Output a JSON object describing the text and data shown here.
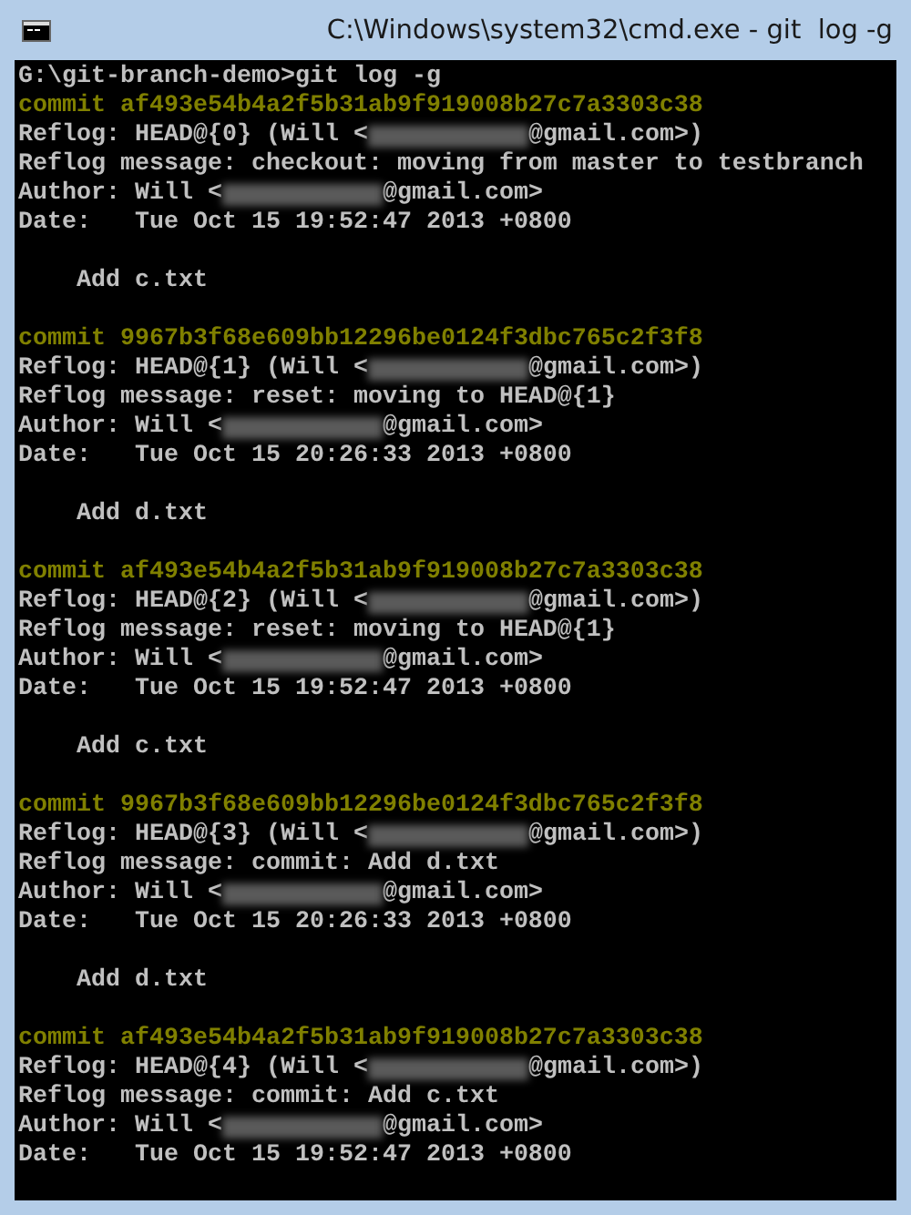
{
  "window": {
    "title": "C:\\Windows\\system32\\cmd.exe - git  log -g"
  },
  "console": {
    "prompt": "G:\\git-branch-demo>git log -g",
    "entries": [
      {
        "commit": "commit af493e54b4a2f5b31ab9f919008b27c7a3303c38",
        "reflog_start": "Reflog: HEAD@{0} (Will <",
        "reflog_end": "@gmail.com>)",
        "message": "Reflog message: checkout: moving from master to testbranch",
        "author_start": "Author: Will <",
        "author_end": "@gmail.com>",
        "date": "Date:   Tue Oct 15 19:52:47 2013 +0800",
        "subject": "    Add c.txt"
      },
      {
        "commit": "commit 9967b3f68e609bb12296be0124f3dbc765c2f3f8",
        "reflog_start": "Reflog: HEAD@{1} (Will <",
        "reflog_end": "@gmail.com>)",
        "message": "Reflog message: reset: moving to HEAD@{1}",
        "author_start": "Author: Will <",
        "author_end": "@gmail.com>",
        "date": "Date:   Tue Oct 15 20:26:33 2013 +0800",
        "subject": "    Add d.txt"
      },
      {
        "commit": "commit af493e54b4a2f5b31ab9f919008b27c7a3303c38",
        "reflog_start": "Reflog: HEAD@{2} (Will <",
        "reflog_end": "@gmail.com>)",
        "message": "Reflog message: reset: moving to HEAD@{1}",
        "author_start": "Author: Will <",
        "author_end": "@gmail.com>",
        "date": "Date:   Tue Oct 15 19:52:47 2013 +0800",
        "subject": "    Add c.txt"
      },
      {
        "commit": "commit 9967b3f68e609bb12296be0124f3dbc765c2f3f8",
        "reflog_start": "Reflog: HEAD@{3} (Will <",
        "reflog_end": "@gmail.com>)",
        "message": "Reflog message: commit: Add d.txt",
        "author_start": "Author: Will <",
        "author_end": "@gmail.com>",
        "date": "Date:   Tue Oct 15 20:26:33 2013 +0800",
        "subject": "    Add d.txt"
      },
      {
        "commit": "commit af493e54b4a2f5b31ab9f919008b27c7a3303c38",
        "reflog_start": "Reflog: HEAD@{4} (Will <",
        "reflog_end": "@gmail.com>)",
        "message": "Reflog message: commit: Add c.txt",
        "author_start": "Author: Will <",
        "author_end": "@gmail.com>",
        "date": "Date:   Tue Oct 15 19:52:47 2013 +0800"
      }
    ]
  }
}
